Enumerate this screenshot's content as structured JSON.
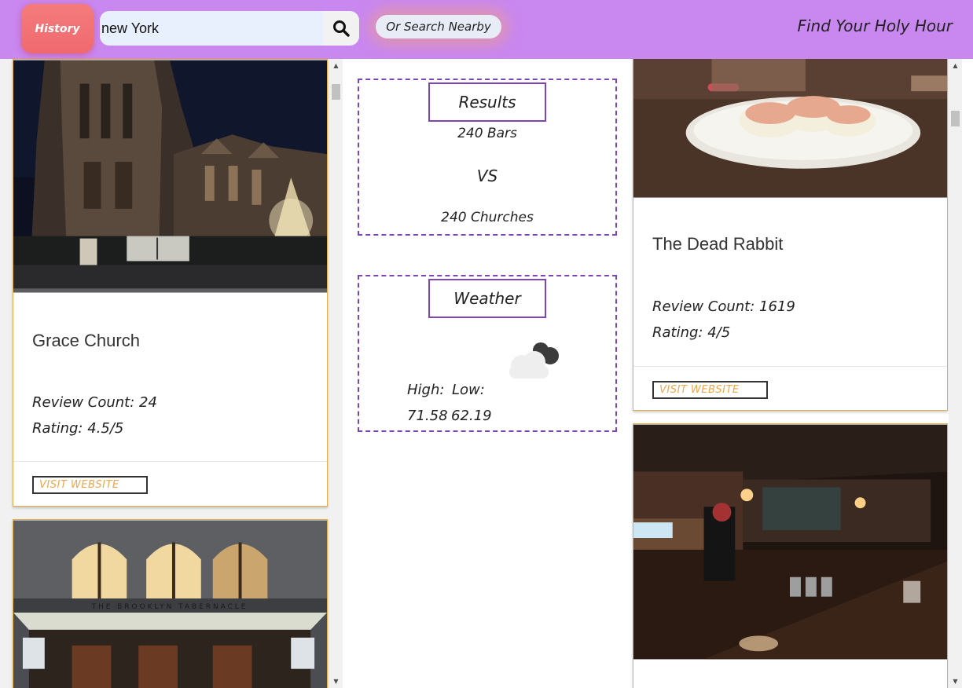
{
  "header": {
    "history_label": "History",
    "search_value": "new York",
    "search_icon": "search-icon",
    "nearby_label": "Or Search Nearby",
    "app_title": "Find Your Holy Hour",
    "colors": {
      "bar": "#c987f0",
      "history": "#ef6a70",
      "search_field": "#e8f0fe"
    }
  },
  "results": {
    "title": "Results",
    "bars": "240 Bars",
    "vs": "VS",
    "churches": "240 Churches"
  },
  "weather": {
    "title": "Weather",
    "icon": "cloudy-icon",
    "high_label": "High:",
    "low_label": "Low:",
    "high_value": "71.58",
    "low_value": "62.19"
  },
  "churches": [
    {
      "name": "Grace Church",
      "review_count": "Review Count: 24",
      "rating": "Rating: 4.5/5",
      "visit_label": "VISIT WEBSITE",
      "image": "gothic-church-at-night"
    },
    {
      "name": "",
      "image": "brooklyn-tabernacle-facade",
      "facade_text": "THE BROOKLYN TABERNACLE"
    }
  ],
  "bars": [
    {
      "name": "The Dead Rabbit",
      "review_count": "Review Count: 1619",
      "rating": "Rating: 4/5",
      "visit_label": "VISIT WEBSITE",
      "image": "deviled-eggs-plate"
    },
    {
      "name": "",
      "image": "dim-bar-interior"
    }
  ]
}
